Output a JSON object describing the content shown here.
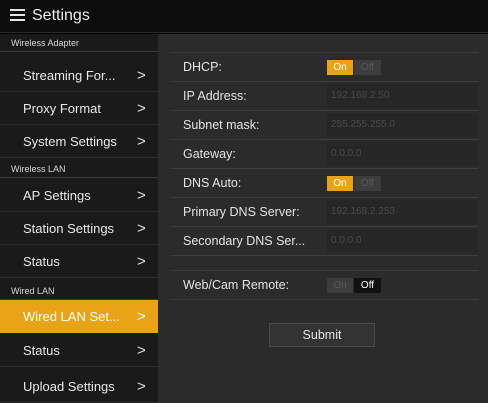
{
  "app": {
    "title": "Settings"
  },
  "sidebar": {
    "sections": [
      {
        "header": "Wireless Adapter",
        "items": [
          "Streaming For...",
          "Proxy Format",
          "System Settings"
        ]
      },
      {
        "header": "Wireless LAN",
        "items": [
          "AP Settings",
          "Station Settings",
          "Status"
        ]
      },
      {
        "header": "Wired LAN",
        "items": [
          "Wired LAN Set...",
          "Status",
          "Upload Settings"
        ]
      }
    ],
    "active_item": "Wired LAN Set...",
    "chevron": ">"
  },
  "form": {
    "dhcp": {
      "label": "DHCP:",
      "on_label": "On",
      "off_label": "Off",
      "value": "On"
    },
    "ip_address": {
      "label": "IP Address:",
      "value": "192.168.2.50"
    },
    "subnet_mask": {
      "label": "Subnet mask:",
      "value": "255.255.255.0"
    },
    "gateway": {
      "label": "Gateway:",
      "value": "0.0.0.0"
    },
    "dns_auto": {
      "label": "DNS Auto:",
      "on_label": "On",
      "off_label": "Off",
      "value": "On"
    },
    "primary_dns": {
      "label": "Primary DNS Server:",
      "value": "192.168.2.253"
    },
    "secondary_dns": {
      "label": "Secondary DNS Ser...",
      "value": "0.0.0.0"
    },
    "web_cam_remote": {
      "label": "Web/Cam Remote:",
      "on_label": "On",
      "off_label": "Off",
      "value": "Off"
    },
    "submit_label": "Submit"
  },
  "colors": {
    "accent": "#e8a316",
    "background": "#000000",
    "panel": "#2b2b2b",
    "sidebar": "#1a1a1a"
  }
}
